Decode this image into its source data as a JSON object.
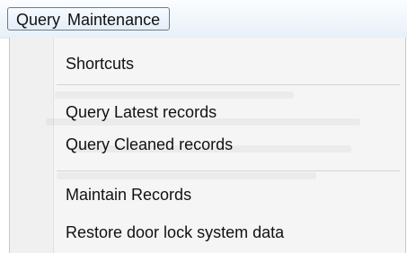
{
  "menubar": {
    "items": [
      {
        "label": "Query",
        "state": "active"
      },
      {
        "label": "Maintenance",
        "state": "active"
      }
    ]
  },
  "dropdown": {
    "items": [
      {
        "label": "Shortcuts"
      },
      {
        "label": "Query Latest records"
      },
      {
        "label": "Query Cleaned records"
      },
      {
        "label": "Maintain Records"
      },
      {
        "label": "Restore door lock system data"
      }
    ]
  },
  "colors": {
    "menu_background": "#f5f5f5",
    "separator": "#d4d4d4",
    "text": "#111111"
  }
}
